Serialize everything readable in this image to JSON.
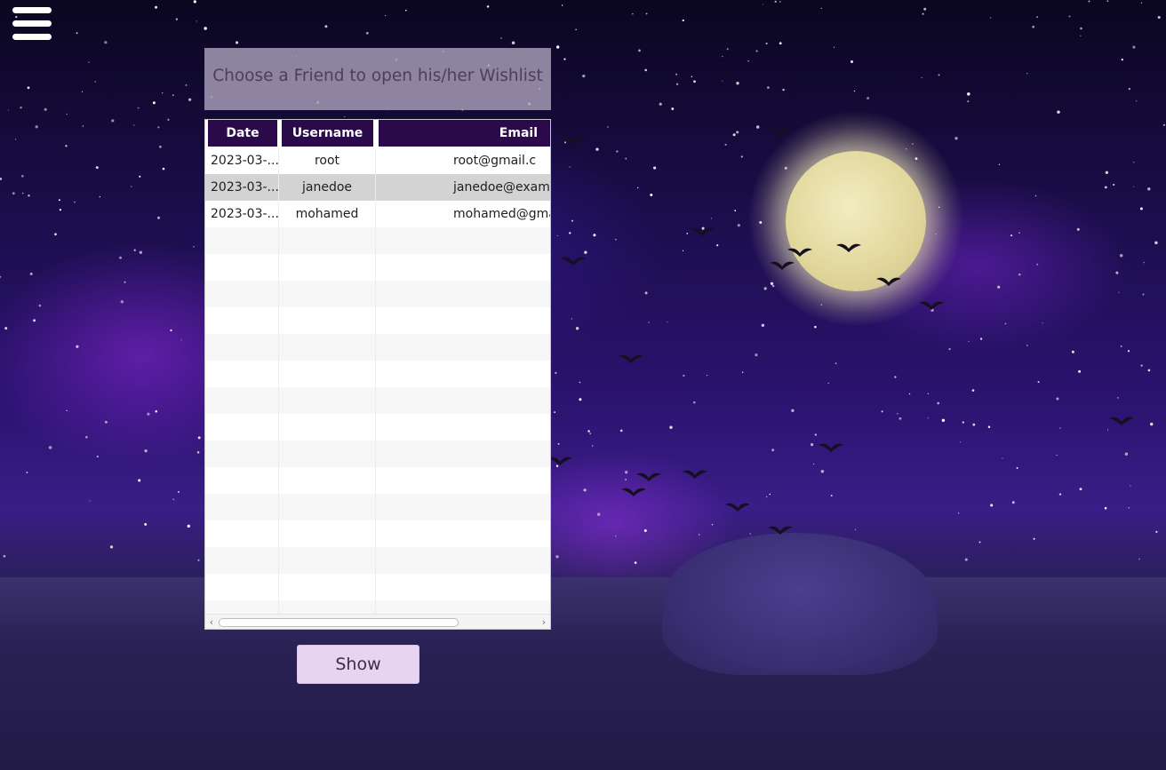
{
  "menu": {
    "icon": "hamburger-menu-icon"
  },
  "prompt": {
    "text": "Choose a Friend to open his/her Wishlist"
  },
  "friends_table": {
    "columns": [
      "Date",
      "Username",
      "Email"
    ],
    "rows": [
      {
        "date": "2023-03-...",
        "username": "root",
        "email": "root@gmail.c"
      },
      {
        "date": "2023-03-...",
        "username": "janedoe",
        "email": "janedoe@examp"
      },
      {
        "date": "2023-03-...",
        "username": "mohamed",
        "email": "mohamed@gma"
      }
    ],
    "selected_row": 1,
    "scrollbar": {
      "left_arrow": "‹",
      "right_arrow": "›"
    }
  },
  "show_button": {
    "label": "Show"
  },
  "colors": {
    "header_bg": "#2b0a4b",
    "button_bg": "#e6d4f1",
    "selected_row_bg": "#d3d3d3"
  }
}
